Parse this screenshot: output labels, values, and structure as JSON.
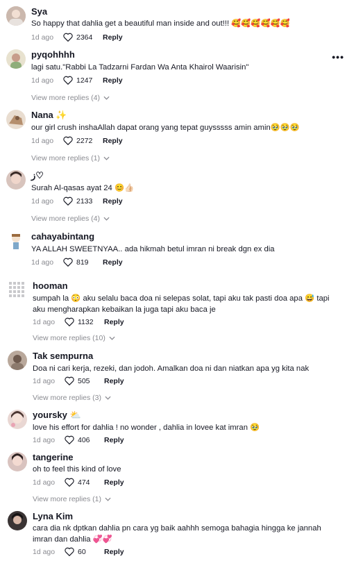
{
  "comments": [
    {
      "name": "Sya",
      "text": "So happy that dahlia get a beautiful man inside and out!!! 🥰🥰🥰🥰🥰🥰",
      "ago": "1d ago",
      "likes": "2364",
      "reply": "Reply",
      "more": ""
    },
    {
      "name": "pyqohhhh",
      "text": "lagi satu.\"Rabbi La Tadzarni Fardan Wa Anta Khairol Waarisin\"",
      "ago": "1d ago",
      "likes": "1247",
      "reply": "Reply",
      "more": "View more replies (4)"
    },
    {
      "name": "Nana ✨",
      "text": "our girl crush inshaAllah dapat orang yang tepat guysssss amin amin🥹🥹🥹",
      "ago": "1d ago",
      "likes": "2272",
      "reply": "Reply",
      "more": "View more replies (1)"
    },
    {
      "name": "ز♡",
      "text": "Surah Al-qasas ayat 24 😊👍🏻",
      "ago": "1d ago",
      "likes": "2133",
      "reply": "Reply",
      "more": "View more replies (4)"
    },
    {
      "name": "cahayabintang",
      "text": "YA ALLAH SWEETNYAA.. ada hikmah betul imran ni break dgn ex dia",
      "ago": "1d ago",
      "likes": "819",
      "reply": "Reply",
      "more": ""
    },
    {
      "name": "hooman",
      "text": "sumpah la 😳 aku selalu baca doa ni selepas solat, tapi aku tak pasti doa apa 😅 tapi aku mengharapkan kebaikan la juga tapi aku baca je",
      "ago": "1d ago",
      "likes": "1132",
      "reply": "Reply",
      "more": "View more replies (10)"
    },
    {
      "name": "Tak sempurna",
      "text": "Doa ni cari kerja, rezeki, dan jodoh. Amalkan doa ni dan niatkan apa yg kita nak",
      "ago": "1d ago",
      "likes": "505",
      "reply": "Reply",
      "more": "View more replies (3)"
    },
    {
      "name": "yoursky ⛅",
      "text": "love his effort for dahlia ! no wonder , dahlia in lovee kat imran 🥹",
      "ago": "1d ago",
      "likes": "406",
      "reply": "Reply",
      "more": ""
    },
    {
      "name": "tangerine",
      "text": "oh to feel this kind of love",
      "ago": "1d ago",
      "likes": "474",
      "reply": "Reply",
      "more": "View more replies (1)"
    },
    {
      "name": "Lyna Kim",
      "text": "cara dia nk dptkan dahlia pn cara yg baik aahhh semoga bahagia hingga ke jannah imran dan dahlia 💞💞",
      "ago": "1d ago",
      "likes": "60",
      "reply": "Reply",
      "more": ""
    }
  ],
  "menu_icon": "more-options-icon"
}
